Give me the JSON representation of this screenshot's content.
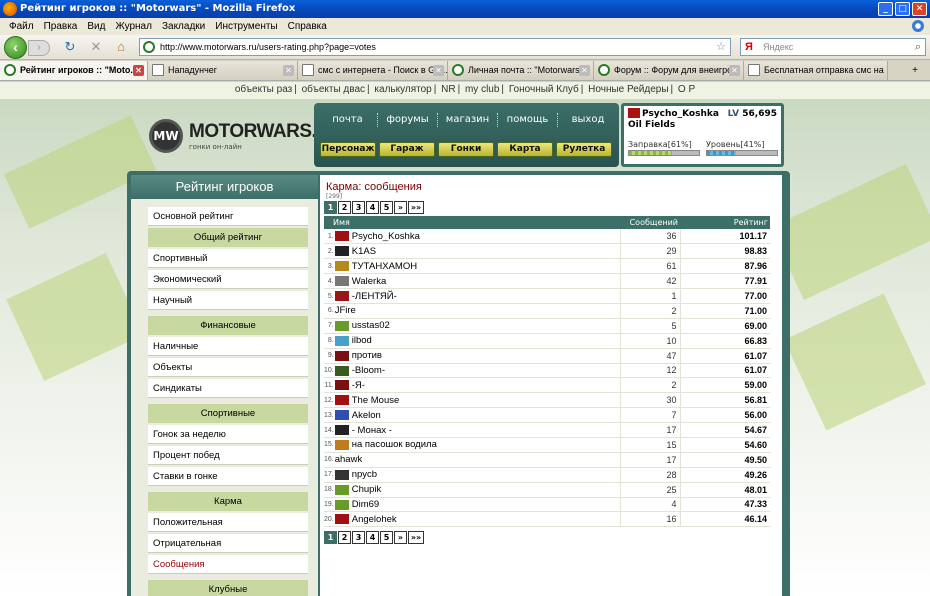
{
  "window": {
    "title": "Рейтинг игроков :: \"Motorwars\" - Mozilla Firefox"
  },
  "menubar": [
    "Файл",
    "Правка",
    "Вид",
    "Журнал",
    "Закладки",
    "Инструменты",
    "Справка"
  ],
  "navbar": {
    "url": "http://www.motorwars.ru/users-rating.php?page=votes",
    "search_placeholder": "Яндекс",
    "search_brand": "Я"
  },
  "tabs": [
    {
      "label": "Рейтинг игроков :: \"Moto...",
      "active": true
    },
    {
      "label": "Нападунчег"
    },
    {
      "label": "смс с интернета - Поиск в Go..."
    },
    {
      "label": "Личная почта :: \"Motorwars\""
    },
    {
      "label": "Форум :: Форум для внеигро..."
    },
    {
      "label": "Бесплатная отправка смс на ..."
    }
  ],
  "toplinks": [
    "объекты раз",
    "объекты двас",
    "калькулятор",
    "NR",
    "my club",
    "Гоночный Клуб",
    "Ночные Рейдеры",
    "О Р"
  ],
  "logo": {
    "mark": "MW",
    "title": "MOTORWARS.RU",
    "subtitle": "гонки он-лайн"
  },
  "mainnav": [
    "почта",
    "форумы",
    "магазин",
    "помощь",
    "выход"
  ],
  "subnav": [
    "Персонаж",
    "Гараж",
    "Гонки",
    "Карта",
    "Рулетка"
  ],
  "user": {
    "name": "Psycho_Koshka",
    "lv_label": "LV",
    "lv": "56,695",
    "location": "Oil Fields",
    "fuel_label": "Заправка[61%]",
    "fuel": 0.61,
    "level_label": "Уровень[41%]",
    "level": 0.41
  },
  "sidebar": {
    "title": "Рейтинг игроков",
    "items": [
      {
        "label": "Основной рейтинг",
        "type": "item"
      },
      {
        "label": "Общий рейтинг",
        "type": "header"
      },
      {
        "label": "Спортивный",
        "type": "item"
      },
      {
        "label": "Экономический",
        "type": "item"
      },
      {
        "label": "Научный",
        "type": "item"
      },
      {
        "label": "Финансовые",
        "type": "header"
      },
      {
        "label": "Наличные",
        "type": "item"
      },
      {
        "label": "Объекты",
        "type": "item"
      },
      {
        "label": "Синдикаты",
        "type": "item"
      },
      {
        "label": "Спортивные",
        "type": "header"
      },
      {
        "label": "Гонок за неделю",
        "type": "item"
      },
      {
        "label": "Процент побед",
        "type": "item"
      },
      {
        "label": "Ставки в гонке",
        "type": "item"
      },
      {
        "label": "Карма",
        "type": "header"
      },
      {
        "label": "Положительная",
        "type": "item"
      },
      {
        "label": "Отрицательная",
        "type": "item"
      },
      {
        "label": "Сообщения",
        "type": "item",
        "selected": true
      },
      {
        "label": "Клубные",
        "type": "header"
      }
    ]
  },
  "main": {
    "title": "Карма: сообщения",
    "total": "[299]",
    "pages": [
      "1",
      "2",
      "3",
      "4",
      "5",
      "»",
      "»»"
    ],
    "columns": {
      "name": "Имя",
      "count": "Сообщений",
      "rating": "Рейтинг"
    },
    "rows": [
      {
        "n": "1.",
        "name": "Psycho_Koshka",
        "count": "36",
        "rating": "101.17",
        "color": "#a01010"
      },
      {
        "n": "2.",
        "name": "K1AS",
        "count": "29",
        "rating": "98.83",
        "color": "#222222"
      },
      {
        "n": "3.",
        "name": "ТУТАНХАМОН",
        "count": "61",
        "rating": "87.96",
        "color": "#b58a1a"
      },
      {
        "n": "4.",
        "name": "Walerka",
        "count": "42",
        "rating": "77.91",
        "color": "#777777"
      },
      {
        "n": "5.",
        "name": "-ЛЕНТЯЙ-",
        "count": "1",
        "rating": "77.00",
        "color": "#9a1515"
      },
      {
        "n": "6.",
        "name": "JFire",
        "count": "2",
        "rating": "71.00",
        "color": ""
      },
      {
        "n": "7.",
        "name": "usstas02",
        "count": "5",
        "rating": "69.00",
        "color": "#6a9a2a"
      },
      {
        "n": "8.",
        "name": "ilbod",
        "count": "10",
        "rating": "66.83",
        "color": "#4aa0c8"
      },
      {
        "n": "9.",
        "name": "против",
        "count": "47",
        "rating": "61.07",
        "color": "#7a1010"
      },
      {
        "n": "10.",
        "name": "-Bloom-",
        "count": "12",
        "rating": "61.07",
        "color": "#3a5a20"
      },
      {
        "n": "11.",
        "name": "-Я-",
        "count": "2",
        "rating": "59.00",
        "color": "#7a1010"
      },
      {
        "n": "12.",
        "name": "The Mouse",
        "count": "30",
        "rating": "56.81",
        "color": "#a01010"
      },
      {
        "n": "13.",
        "name": "Akelon",
        "count": "7",
        "rating": "56.00",
        "color": "#3050b0"
      },
      {
        "n": "14.",
        "name": "- Монах -",
        "count": "17",
        "rating": "54.67",
        "color": "#222222"
      },
      {
        "n": "15.",
        "name": "на пасошок водила",
        "count": "15",
        "rating": "54.60",
        "color": "#c07a20"
      },
      {
        "n": "16.",
        "name": "ahawk",
        "count": "17",
        "rating": "49.50",
        "color": ""
      },
      {
        "n": "17.",
        "name": "npycb",
        "count": "28",
        "rating": "49.26",
        "color": "#333333"
      },
      {
        "n": "18.",
        "name": "Chupik",
        "count": "25",
        "rating": "48.01",
        "color": "#6a9a2a"
      },
      {
        "n": "19.",
        "name": "Dim69",
        "count": "4",
        "rating": "47.33",
        "color": "#6a9a2a"
      },
      {
        "n": "20.",
        "name": "Angelohek",
        "count": "16",
        "rating": "46.14",
        "color": "#a01010"
      }
    ]
  }
}
